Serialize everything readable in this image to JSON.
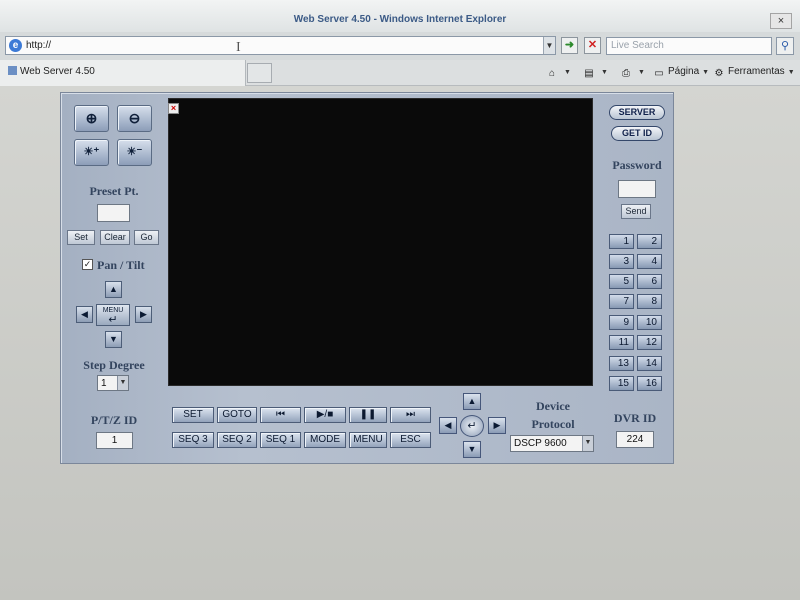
{
  "browser": {
    "title": "Web Server 4.50 - Windows Internet Explorer",
    "close_glyph": "×",
    "address": "http://",
    "search_placeholder": "Live Search",
    "tab_label": "Web Server 4.50",
    "toolbar": {
      "page_label": "Página",
      "tools_label": "Ferramentas"
    }
  },
  "dvr": {
    "video_close": "×",
    "zoom_in_glyph": "⊕",
    "zoom_out_glyph": "⊖",
    "bright_up_glyph": "☀⁺",
    "bright_down_glyph": "☀⁻",
    "preset": {
      "label": "Preset Pt.",
      "value": "",
      "set": "Set",
      "clear": "Clear",
      "go": "Go"
    },
    "pantilt": {
      "label": "Pan / Tilt",
      "checked": "✓",
      "menu": "MENU",
      "enter": "↵"
    },
    "step_degree": {
      "label": "Step Degree",
      "value": "1"
    },
    "ptz_id": {
      "label": "P/T/Z  ID",
      "value": "1"
    },
    "controls_row1": [
      "SET",
      "GOTO",
      "⏮",
      "▶/■",
      "❚❚",
      "⏭"
    ],
    "controls_row2": [
      "SEQ 3",
      "SEQ 2",
      "SEQ 1",
      "MODE",
      "MENU",
      "ESC"
    ],
    "device_protocol": {
      "label1": "Device",
      "label2": "Protocol",
      "value": "DSCP 9600"
    },
    "server_btn": "SERVER",
    "getid_btn": "GET ID",
    "password": {
      "label": "Password",
      "value": "",
      "send": "Send"
    },
    "channels": [
      "1",
      "2",
      "3",
      "4",
      "5",
      "6",
      "7",
      "8",
      "9",
      "10",
      "11",
      "12",
      "13",
      "14",
      "15",
      "16"
    ],
    "dvr_id": {
      "label": "DVR ID",
      "value": "224"
    },
    "arrows": {
      "up": "▲",
      "down": "▼",
      "left": "◀",
      "right": "▶",
      "dd": "▼"
    }
  }
}
